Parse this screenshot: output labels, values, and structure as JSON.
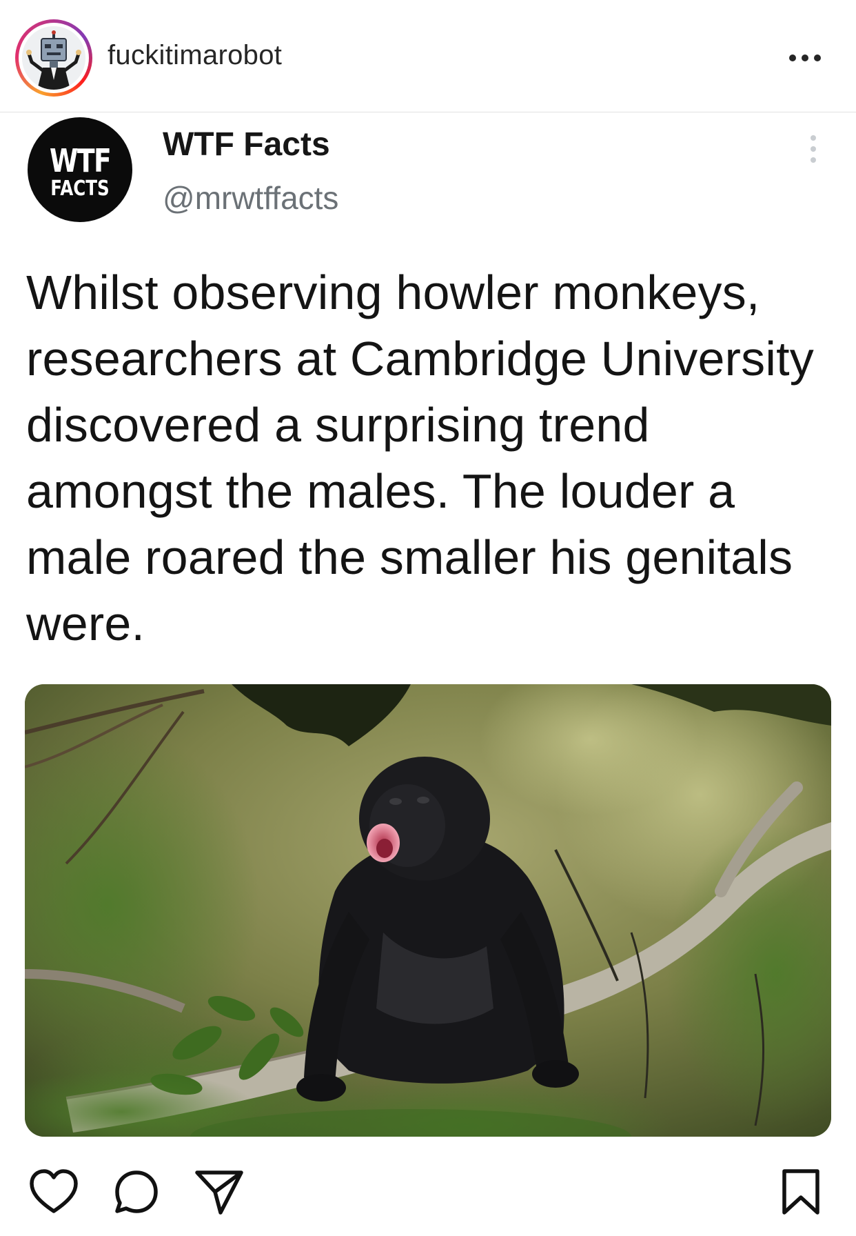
{
  "post": {
    "username": "fuckitimarobot"
  },
  "tweet": {
    "display_name": "WTF Facts",
    "handle": "@mrwtffacts",
    "avatar_logo": {
      "line1": "WTF",
      "line2": "FACTS"
    },
    "text": "Whilst observing howler monkeys, researchers at Cambridge University discovered a surprising trend amongst the males. The louder a male roared the smaller his genitals were."
  },
  "icons": {
    "more": "more-horizontal-icon",
    "tweet_more": "more-vertical-icon",
    "like": "heart-icon",
    "comment": "comment-bubble-icon",
    "share": "paper-plane-icon",
    "save": "bookmark-icon"
  },
  "colors": {
    "story_ring": "#e1306c",
    "text": "#141414",
    "handle": "#6b7176",
    "icon": "#111111"
  }
}
